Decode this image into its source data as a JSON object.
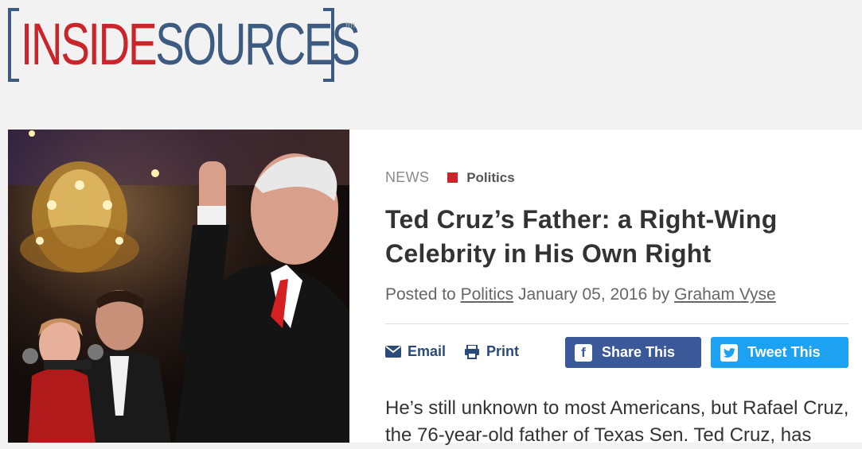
{
  "brand": {
    "inside": "INSIDE",
    "sources": "SOURCES",
    "tm": "tm",
    "colors": {
      "red": "#c8262b",
      "blue": "#3d5a80"
    }
  },
  "article": {
    "section": "NEWS",
    "category": "Politics",
    "title": "Ted Cruz’s Father: a Right-Wing Celebrity in His Own Right",
    "meta": {
      "posted_to": "Posted to",
      "category_link": "Politics",
      "date": "January 05, 2016",
      "by": "by",
      "author": "Graham Vyse"
    },
    "actions": {
      "email": "Email",
      "print": "Print",
      "share": "Share This",
      "tweet": "Tweet This"
    },
    "body": "He’s still unknown to most Americans, but Rafael Cruz, the 76-year-old father of Texas Sen. Ted Cruz, has"
  },
  "colors": {
    "facebook": "#3b5998",
    "twitter": "#1da1f2",
    "link": "#2a4a7a"
  }
}
